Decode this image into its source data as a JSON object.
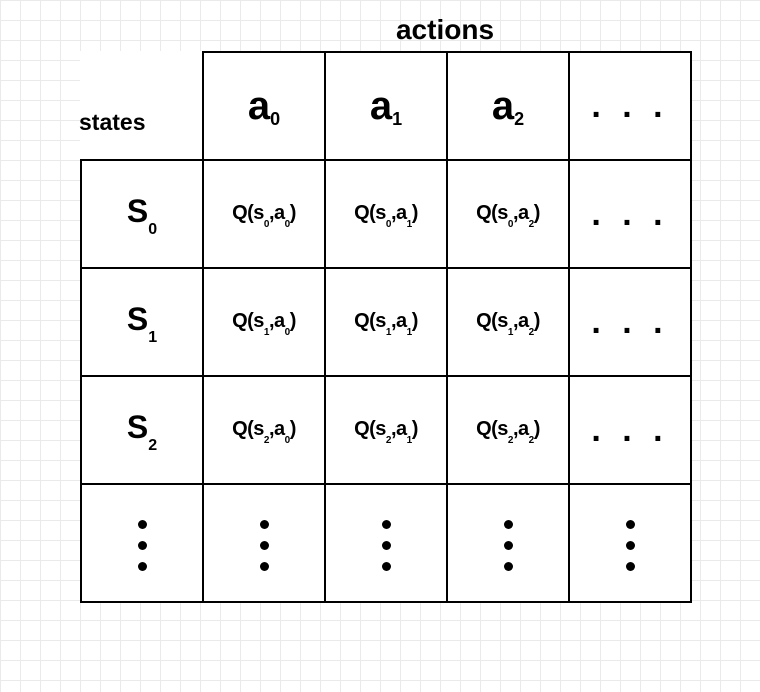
{
  "labels": {
    "actions": "actions",
    "states": "states"
  },
  "headers": {
    "a0_main": "a",
    "a0_sub": "0",
    "a1_main": "a",
    "a1_sub": "1",
    "a2_main": "a",
    "a2_sub": "2"
  },
  "rowheads": {
    "s0_main": "S",
    "s0_sub": "0",
    "s1_main": "S",
    "s1_sub": "1",
    "s2_main": "S",
    "s2_sub": "2"
  },
  "cells": {
    "q00_a": "Q(s",
    "q00_b": "0",
    "q00_c": ",a",
    "q00_d": "0",
    "q00_e": ")",
    "q01_a": "Q(s",
    "q01_b": "0",
    "q01_c": ",a",
    "q01_d": "1",
    "q01_e": ")",
    "q02_a": "Q(s",
    "q02_b": "0",
    "q02_c": ",a",
    "q02_d": "2",
    "q02_e": ")",
    "q10_a": "Q(s",
    "q10_b": "1",
    "q10_c": ",a",
    "q10_d": "0",
    "q10_e": ")",
    "q11_a": "Q(s",
    "q11_b": "1",
    "q11_c": ",a",
    "q11_d": "1",
    "q11_e": ")",
    "q12_a": "Q(s",
    "q12_b": "1",
    "q12_c": ",a",
    "q12_d": "2",
    "q12_e": ")",
    "q20_a": "Q(s",
    "q20_b": "2",
    "q20_c": ",a",
    "q20_d": "0",
    "q20_e": ")",
    "q21_a": "Q(s",
    "q21_b": "2",
    "q21_c": ",a",
    "q21_d": "1",
    "q21_e": ")",
    "q22_a": "Q(s",
    "q22_b": "2",
    "q22_c": ",a",
    "q22_d": "2",
    "q22_e": ")"
  },
  "ellipsis": ". . .",
  "chart_data": {
    "type": "table",
    "title": "Q-table (state-action value table)",
    "column_label": "actions",
    "row_label": "states",
    "columns": [
      "a₀",
      "a₁",
      "a₂",
      "…"
    ],
    "rows": [
      "S₀",
      "S₁",
      "S₂",
      "⋮"
    ],
    "cells": [
      [
        "Q(s₀,a₀)",
        "Q(s₀,a₁)",
        "Q(s₀,a₂)",
        "…"
      ],
      [
        "Q(s₁,a₀)",
        "Q(s₁,a₁)",
        "Q(s₁,a₂)",
        "…"
      ],
      [
        "Q(s₂,a₀)",
        "Q(s₂,a₁)",
        "Q(s₂,a₂)",
        "…"
      ],
      [
        "⋮",
        "⋮",
        "⋮",
        "⋮"
      ]
    ]
  }
}
